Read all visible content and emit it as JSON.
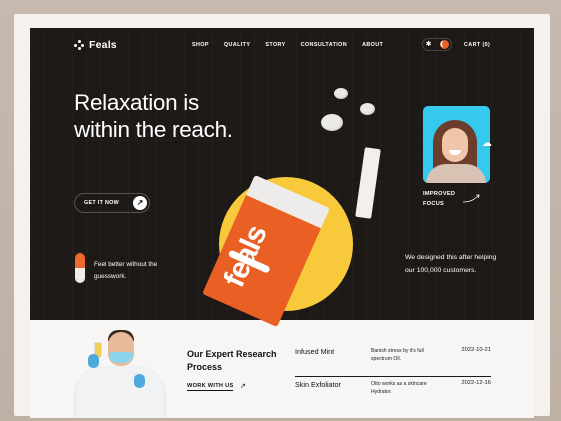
{
  "brand": {
    "name": "Feals"
  },
  "nav": {
    "items": [
      "SHOP",
      "QUALITY",
      "STORY",
      "CONSULTATION",
      "ABOUT"
    ],
    "cart": "CART (0)"
  },
  "hero": {
    "headline": "Relaxation is within the reach.",
    "cta": "GET IT NOW",
    "pill_text": "Feel better without the guesswork.",
    "product_brand": "feals",
    "card_label": "IMPROVED FOCUS",
    "right_text": "We designed this after helping our 100,000 customers."
  },
  "research": {
    "title": "Our Expert Research Process",
    "link": "WORK WITH US",
    "rows": [
      {
        "name": "Infused Mint",
        "desc": "Banish stress by it's full spectrum Oil.",
        "date": "2022-10-21"
      },
      {
        "name": "Skin Exfoliator",
        "desc": "Otto works as a skincare Hydrator.",
        "date": "2022-12-16"
      }
    ]
  },
  "colors": {
    "accent": "#e95f24",
    "dark": "#1d1917",
    "yellow": "#f8c93a",
    "cyan": "#36c9ee"
  }
}
